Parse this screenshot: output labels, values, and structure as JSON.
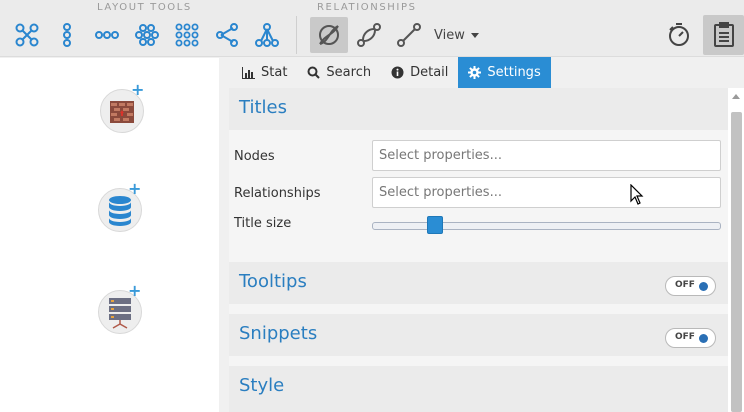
{
  "toolbar": {
    "layout_tools_label": "LAYOUT TOOLS",
    "relationships_label": "RELATIONSHIPS",
    "layout_tools": [
      {
        "icon": "network-layout-icon"
      },
      {
        "icon": "vertical-chain-layout-icon"
      },
      {
        "icon": "horizontal-chain-layout-icon"
      },
      {
        "icon": "cluster-layout-icon"
      },
      {
        "icon": "grid-layout-icon"
      },
      {
        "icon": "share-layout-icon"
      },
      {
        "icon": "hierarchy-layout-icon"
      }
    ],
    "relationship_tools": [
      {
        "icon": "curved-relationships-icon",
        "active": true
      },
      {
        "icon": "bidirectional-link-icon"
      },
      {
        "icon": "straight-link-icon"
      }
    ],
    "view_label": "View",
    "right_icons": [
      "timer-icon",
      "notes-icon"
    ]
  },
  "palette": {
    "items": [
      {
        "icon": "add-brick-node-icon"
      },
      {
        "icon": "add-database-node-icon"
      },
      {
        "icon": "add-server-node-icon"
      }
    ]
  },
  "tabs": [
    {
      "label": "Stat",
      "icon": "bar-chart-icon"
    },
    {
      "label": "Search",
      "icon": "search-icon"
    },
    {
      "label": "Detail",
      "icon": "info-icon"
    },
    {
      "label": "Settings",
      "icon": "gear-icon",
      "active": true
    }
  ],
  "settings": {
    "titles": {
      "heading": "Titles",
      "nodes_label": "Nodes",
      "nodes_placeholder": "Select properties...",
      "relationships_label": "Relationships",
      "relationships_placeholder": "Select properties...",
      "title_size_label": "Title size",
      "title_size_value": 0.18
    },
    "tooltips": {
      "heading": "Tooltips",
      "toggle": "OFF"
    },
    "snippets": {
      "heading": "Snippets",
      "toggle": "OFF"
    },
    "style": {
      "heading": "Style"
    }
  },
  "colors": {
    "accent": "#2a8dd4",
    "heading": "#2a7ec0",
    "icon_blue": "#2a86cf"
  }
}
